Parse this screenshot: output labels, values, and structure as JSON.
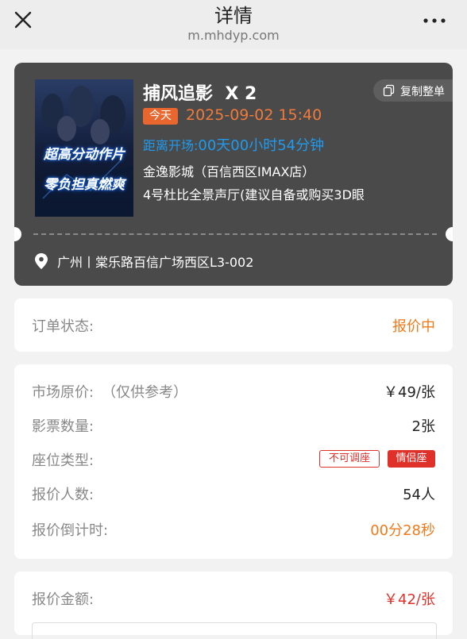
{
  "header": {
    "title": "详情",
    "subtitle": "m.mhdyp.com",
    "close_icon": "close-icon",
    "more_icon": "more-icon"
  },
  "ticket": {
    "movie_title": "捕风追影  X 2",
    "copy_button": "复制整单",
    "today_badge": "今天",
    "showtime": "2025-09-02 15:40",
    "countdown_prefix": "距离开场:",
    "countdown_value": "00天00小时54分钟",
    "cinema": "金逸影城（百信西区IMAX店）",
    "hall": "4号杜比全景声厅(建议自备或购买3D眼",
    "address": "广州丨棠乐路百信广场西区L3-002",
    "poster_line1": "超高分动作片",
    "poster_line2": "零负担真燃爽"
  },
  "status_card": {
    "label": "订单状态:",
    "value": "报价中"
  },
  "details_card": {
    "market_price_label": "市场原价:",
    "market_price_note": "（仅供参考）",
    "market_price_value": "￥49/张",
    "ticket_count_label": "影票数量:",
    "ticket_count_value": "2张",
    "seat_type_label": "座位类型:",
    "seat_tag_1": "不可调座",
    "seat_tag_2": "情侣座",
    "bidders_label": "报价人数:",
    "bidders_value": "54人",
    "timer_label": "报价倒计时:",
    "timer_value": "00分28秒"
  },
  "quote_card": {
    "label": "报价金额:",
    "value": "￥42/张"
  },
  "colors": {
    "accent_orange": "#f07a1a",
    "accent_red": "#e0302a",
    "accent_blue": "#1e9bf0",
    "ticket_bg": "#4a4a4a"
  }
}
